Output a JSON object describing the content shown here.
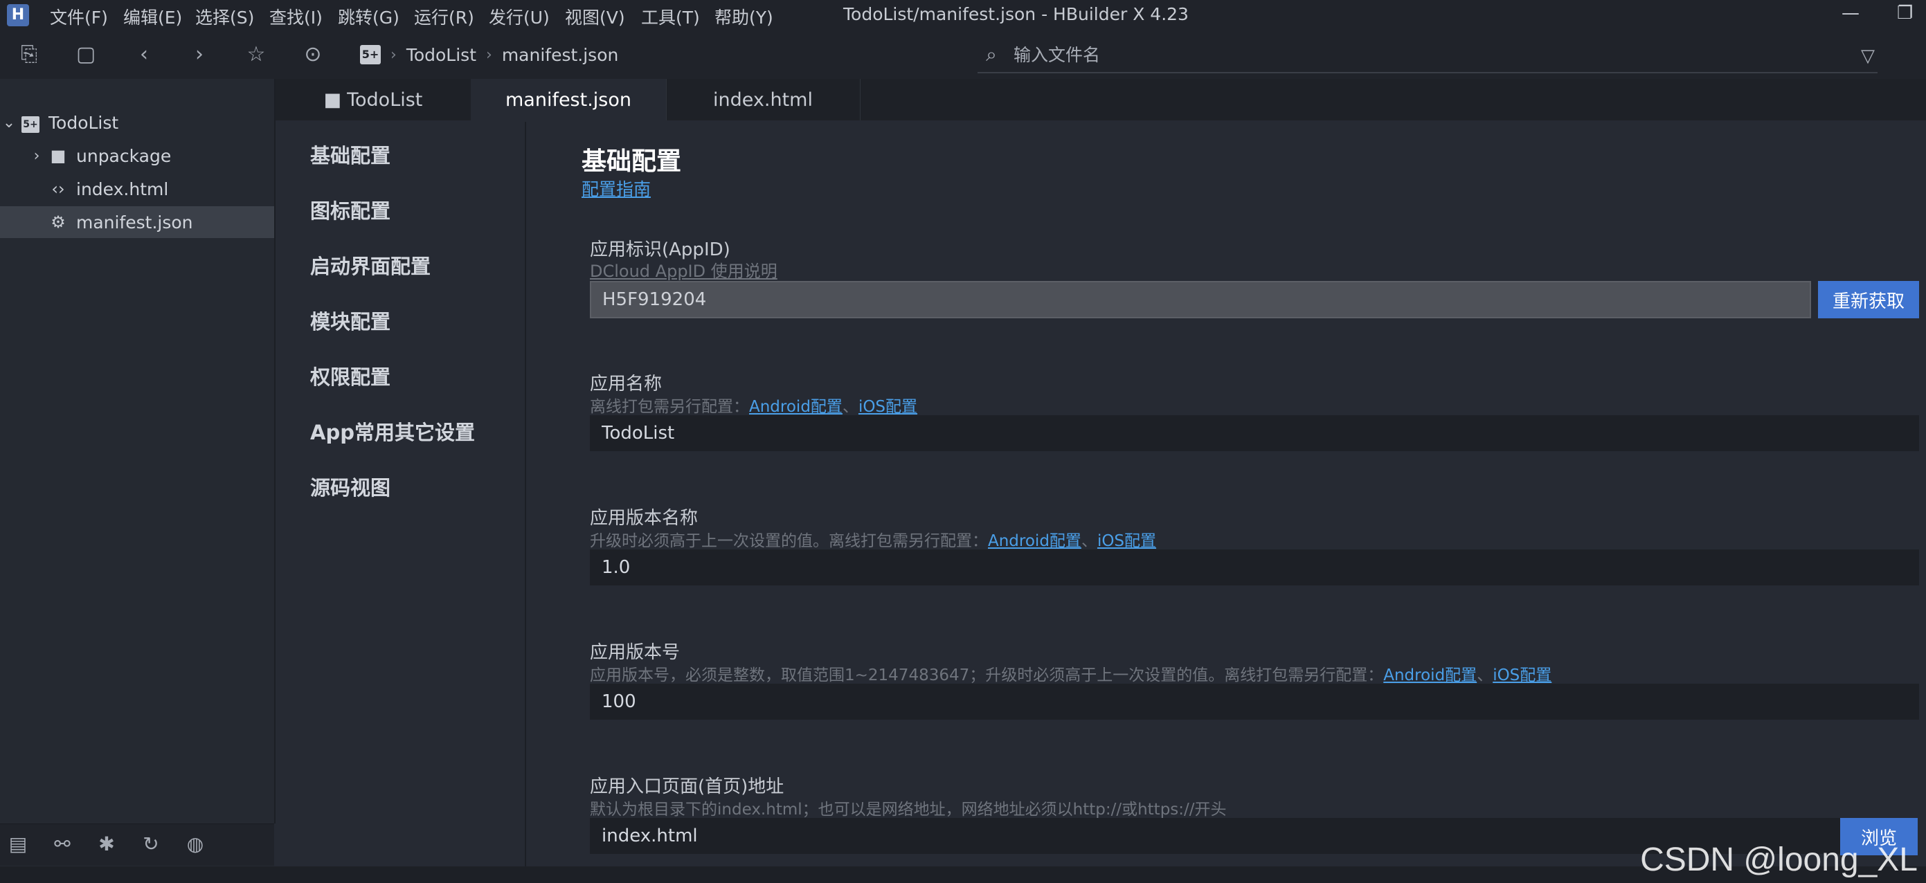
{
  "menubar": {
    "items": [
      "文件(F)",
      "编辑(E)",
      "选择(S)",
      "查找(I)",
      "跳转(G)",
      "运行(R)",
      "发行(U)",
      "视图(V)",
      "工具(T)",
      "帮助(Y)"
    ],
    "window_title": "TodoList/manifest.json - HBuilder X 4.23"
  },
  "toolbar": {
    "breadcrumb": [
      "TodoList",
      "manifest.json"
    ],
    "breadcrumb_logo": "5+",
    "search_placeholder": "输入文件名"
  },
  "tree": {
    "project": "TodoList",
    "project_logo": "5+",
    "items": [
      "unpackage",
      "index.html",
      "manifest.json"
    ]
  },
  "tabs": [
    "TodoList",
    "manifest.json",
    "index.html"
  ],
  "config_nav": [
    "基础配置",
    "图标配置",
    "启动界面配置",
    "模块配置",
    "权限配置",
    "App常用其它设置",
    "源码视图"
  ],
  "content": {
    "section_title": "基础配置",
    "guide_link": "配置指南",
    "appid": {
      "label": "应用标识(AppID)",
      "help_link": "DCloud AppID 使用说明",
      "value": "H5F919204",
      "button": "重新获取"
    },
    "app_name": {
      "label": "应用名称",
      "desc": "离线打包需另行配置：",
      "link_android": "Android配置",
      "sep": "、",
      "link_ios": "iOS配置",
      "value": "TodoList"
    },
    "version_name": {
      "label": "应用版本名称",
      "desc": "升级时必须高于上一次设置的值。离线打包需另行配置：",
      "link_android": "Android配置",
      "sep": "、",
      "link_ios": "iOS配置",
      "value": "1.0"
    },
    "version_code": {
      "label": "应用版本号",
      "desc": "应用版本号，必须是整数，取值范围1~2147483647；升级时必须高于上一次设置的值。离线打包需另行配置：",
      "link_android": "Android配置",
      "sep": "、",
      "link_ios": "iOS配置",
      "value": "100"
    },
    "entry_page": {
      "label": "应用入口页面(首页)地址",
      "desc": "默认为根目录下的index.html；也可以是网络地址，网络地址必须以http://或https://开头",
      "value": "index.html",
      "button": "浏览"
    }
  },
  "watermark": "CSDN @loong_XL",
  "colors": {
    "accent_button": "#3f74d0",
    "link": "#4a9fe8",
    "background": "#262a33"
  }
}
